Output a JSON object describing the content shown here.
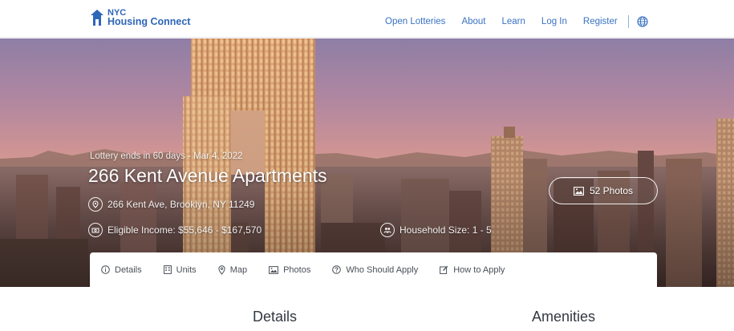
{
  "header": {
    "logo_line1": "NYC",
    "logo_line2": "Housing Connect",
    "nav": [
      "Open Lotteries",
      "About",
      "Learn",
      "Log In",
      "Register"
    ],
    "globe_icon": "globe-icon"
  },
  "hero": {
    "lottery_ends": "Lottery ends in 60 days - Mar 4, 2022",
    "title": "266 Kent Avenue Apartments",
    "address": "266 Kent Ave, Brooklyn, NY 11249",
    "income": "Eligible Income: $55,646 - $167,570",
    "household": "Household Size: 1 - 5",
    "photos_label": "52 Photos"
  },
  "tabs": [
    {
      "label": "Details",
      "icon": "info-icon"
    },
    {
      "label": "Units",
      "icon": "building-icon"
    },
    {
      "label": "Map",
      "icon": "map-pin-icon"
    },
    {
      "label": "Photos",
      "icon": "image-icon"
    },
    {
      "label": "Who Should Apply",
      "icon": "question-icon"
    },
    {
      "label": "How to Apply",
      "icon": "edit-icon"
    }
  ],
  "sections": {
    "details": "Details",
    "amenities": "Amenities"
  },
  "colors": {
    "brand_blue": "#2e66b8",
    "nav_link": "#3a72c2"
  }
}
